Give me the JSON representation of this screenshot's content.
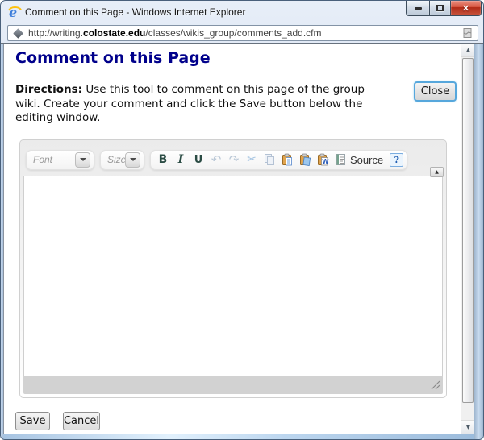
{
  "window": {
    "title": "Comment on this Page - Windows Internet Explorer",
    "controls": {
      "close_glyph": "✕"
    }
  },
  "address_bar": {
    "url_prefix": "http://writing.",
    "url_domain": "colostate.edu",
    "url_path": "/classes/wikis_group/comments_add.cfm"
  },
  "page": {
    "heading": "Comment on this Page",
    "directions": {
      "label": "Directions:",
      "line1_rest": " Use this tool to comment on this page of the group",
      "line2": "wiki. Create your comment and click the Save button below the",
      "line3": "editing window."
    },
    "close_button": "Close",
    "save_button": "Save",
    "cancel_button": "Cancel"
  },
  "editor": {
    "font_combo_label": "Font",
    "size_combo_label": "Size",
    "bold_label": "B",
    "italic_label": "I",
    "underline_label": "U",
    "undo_glyph": "↶",
    "redo_glyph": "↷",
    "cut_glyph": "✂",
    "paste_word_letter": "W",
    "source_label": "Source",
    "help_glyph": "?",
    "collapse_glyph": "▲",
    "content": ""
  },
  "scrollbar": {
    "up_glyph": "▲",
    "down_glyph": "▼"
  },
  "icons": {
    "ie_logo_letter": "e"
  },
  "colors": {
    "heading": "#00008B",
    "close_focus_ring": "#56A7DC",
    "titlebar_close_red": "#C8402A",
    "aero_top": "#E7EEF8",
    "aero_bottom": "#B6C7DC",
    "editor_chrome": "#EDEDED",
    "editor_footer_gray": "#D2D2D2"
  }
}
